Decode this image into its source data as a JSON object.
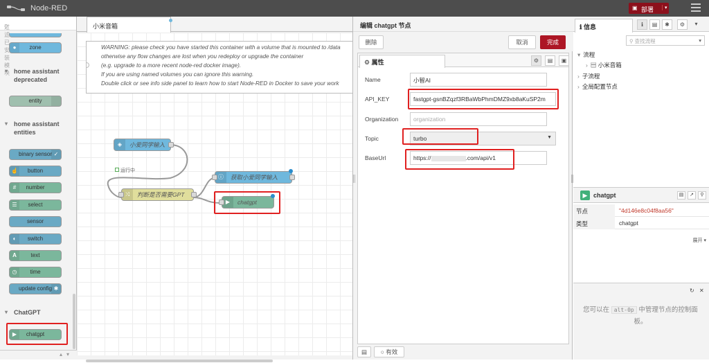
{
  "app": {
    "title": "Node-RED",
    "deploy_label": "部署"
  },
  "palette": {
    "search_placeholder": "过滤已安装模块",
    "categories": [
      {
        "label": "home assistant deprecated"
      },
      {
        "label": "home assistant entities"
      },
      {
        "label": "ChatGPT"
      }
    ],
    "nodes": {
      "zone": "zone",
      "entity": "entity",
      "binary_sensor": "binary sensor",
      "button": "button",
      "number": "number",
      "select": "select",
      "sensor": "sensor",
      "switch": "switch",
      "text": "text",
      "time": "time",
      "update_config": "update config",
      "chatgpt": "chatgpt"
    }
  },
  "workspace": {
    "tab_label": "小米音箱",
    "comment_lines": [
      "WARNING: please check you have started this container with a volume that is mounted to /data",
      "otherwise any flow changes are lost when you redeploy or upgrade the container",
      "(e.g. upgrade to a more recent node-red docker image).",
      "If you are using named volumes you can ignore this warning.",
      "Double click or see info side panel to learn how to start Node-RED in Docker to save your work"
    ],
    "nodes": {
      "input_node": "小爱同学输入",
      "input_status": "运行中",
      "switch_node": "判断是否需要GPT",
      "get_node": "获取小爱同学输入",
      "chatgpt_node": "chatgpt"
    }
  },
  "editor": {
    "title": "编辑 chatgpt 节点",
    "delete_label": "删除",
    "cancel_label": "取消",
    "done_label": "完成",
    "props_tab": "属性",
    "fields": {
      "name_label": "Name",
      "name_value": "小智AI",
      "apikey_label": "API_KEY",
      "apikey_value": "fastgpt-gsnBZqzf3RBaWbPhmDMZ9xb8aKuSP2m",
      "org_label": "Organization",
      "org_placeholder": "organization",
      "topic_label": "Topic",
      "topic_value": "turbo",
      "baseurl_label": "BaseUrl",
      "baseurl_prefix": "https://",
      "baseurl_suffix": ".com/api/v1"
    },
    "enabled_label": "有效"
  },
  "sidebar": {
    "tab_label": "信息",
    "search_placeholder": "查找流程",
    "tree": {
      "flows": "流程",
      "flow_item": "小米音箱",
      "subflows": "子流程",
      "global_config": "全局配置节点"
    },
    "node_info": {
      "name": "chatgpt",
      "rows": [
        {
          "key": "节点",
          "value": "\"4d146e8c04f8aa56\""
        },
        {
          "key": "类型",
          "value": "chatgpt"
        }
      ],
      "more_label": "展开"
    },
    "help": {
      "before": "您可以在",
      "shortcut": "alt-0p",
      "after": "中管理节点的控制面板。"
    }
  },
  "colors": {
    "deploy": "#8c101c",
    "highlight": "#e02020",
    "chatgpt": "#7bb79c",
    "ha_blue": "#6fb8dd"
  }
}
